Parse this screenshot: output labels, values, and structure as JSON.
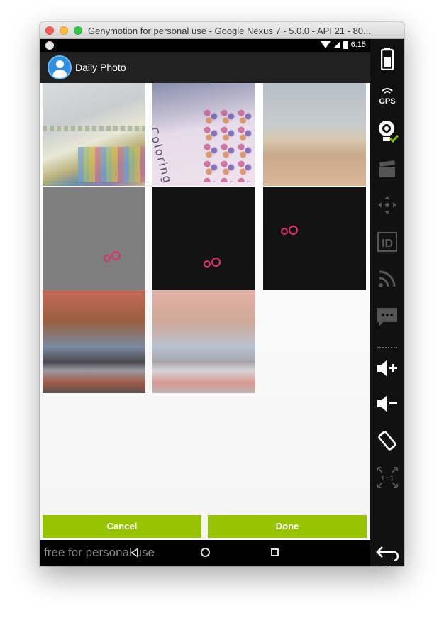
{
  "window": {
    "title": "Genymotion for personal use - Google Nexus 7 - 5.0.0 - API 21 - 80..."
  },
  "statusbar": {
    "time": "6:15"
  },
  "app": {
    "title": "Daily Photo"
  },
  "grid": {
    "tiles": [
      "photo-1",
      "photo-2",
      "photo-3",
      "gray-ring",
      "dark-ring",
      "dark-ring",
      "photo-7",
      "photo-8"
    ],
    "photo2_text": "Coloring B"
  },
  "buttons": {
    "cancel": "Cancel",
    "done": "Done"
  },
  "navbar": {
    "watermark": "free for personal use"
  },
  "sidebar": {
    "gps_label": "GPS",
    "id_label": "ID",
    "ratio_label": "1 : 1"
  },
  "colors": {
    "accent": "#96c400",
    "ring": "#e0306a",
    "appbar": "#212121"
  }
}
